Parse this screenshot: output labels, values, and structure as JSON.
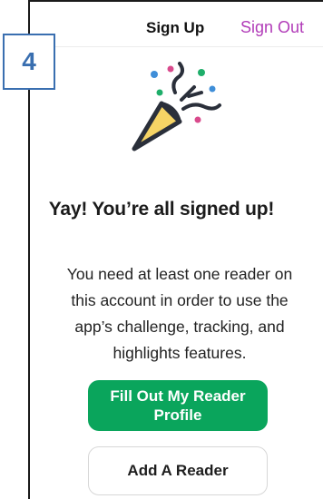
{
  "nav": {
    "title": "Sign Up",
    "sign_out_label": "Sign Out"
  },
  "step_badge": "4",
  "hero_icon": "party-popper-icon",
  "headline": "Yay! You’re all signed up!",
  "body": {
    "lines": [
      "You need at least one reader on",
      "this account in order to use the",
      "app’s challenge, tracking, and",
      "highlights features."
    ]
  },
  "buttons": {
    "primary_lines": [
      "Fill Out My Reader",
      "Profile"
    ],
    "secondary_label": "Add A Reader"
  },
  "colors": {
    "accent_purple": "#b13bb8",
    "primary_green": "#0aa55c",
    "badge_blue": "#3a6fb0",
    "popper_yellow": "#f6d465",
    "confetti_blue": "#3f8ed8",
    "confetti_pink": "#d94a8c",
    "confetti_green": "#1fae6a"
  }
}
